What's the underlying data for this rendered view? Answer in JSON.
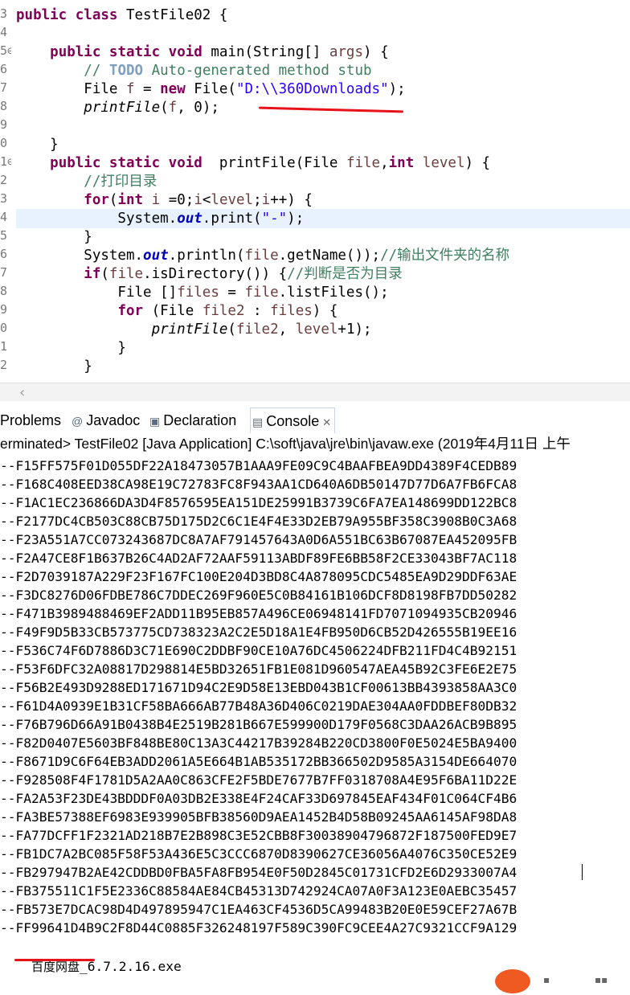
{
  "editor": {
    "line_numbers": [
      "3",
      "4",
      "5⊖",
      "6",
      "7",
      "8",
      "9",
      "0",
      "1⊖",
      "2",
      "3",
      "4",
      "5",
      "6",
      "7",
      "8",
      "9",
      "0",
      "1",
      "2"
    ],
    "lines": [
      [
        {
          "t": "public class",
          "c": "kw"
        },
        {
          "t": " TestFile02 {"
        }
      ],
      [],
      [
        {
          "t": "    "
        },
        {
          "t": "public static void",
          "c": "kw"
        },
        {
          "t": " main(String[] "
        },
        {
          "t": "args",
          "c": "var"
        },
        {
          "t": ") {"
        }
      ],
      [
        {
          "t": "        // ",
          "c": "cm"
        },
        {
          "t": "TODO",
          "c": "todo"
        },
        {
          "t": " Auto-generated method stub",
          "c": "cm"
        }
      ],
      [
        {
          "t": "        File "
        },
        {
          "t": "f",
          "c": "var"
        },
        {
          "t": " = "
        },
        {
          "t": "new",
          "c": "kw"
        },
        {
          "t": " File("
        },
        {
          "t": "\"D:\\\\360Downloads\"",
          "c": "str"
        },
        {
          "t": ");"
        }
      ],
      [
        {
          "t": "        "
        },
        {
          "t": "printFile",
          "c": "ital"
        },
        {
          "t": "("
        },
        {
          "t": "f",
          "c": "var"
        },
        {
          "t": ", 0);"
        }
      ],
      [],
      [
        {
          "t": "    }"
        }
      ],
      [
        {
          "t": "    "
        },
        {
          "t": "public static void",
          "c": "kw"
        },
        {
          "t": "  printFile(File "
        },
        {
          "t": "file",
          "c": "var"
        },
        {
          "t": ","
        },
        {
          "t": "int",
          "c": "kw"
        },
        {
          "t": " "
        },
        {
          "t": "level",
          "c": "var"
        },
        {
          "t": ") {"
        }
      ],
      [
        {
          "t": "        //打印目录",
          "c": "cm"
        }
      ],
      [
        {
          "t": "        "
        },
        {
          "t": "for",
          "c": "kw"
        },
        {
          "t": "("
        },
        {
          "t": "int",
          "c": "kw"
        },
        {
          "t": " "
        },
        {
          "t": "i",
          "c": "var"
        },
        {
          "t": " =0;"
        },
        {
          "t": "i",
          "c": "var"
        },
        {
          "t": "<"
        },
        {
          "t": "level",
          "c": "var"
        },
        {
          "t": ";"
        },
        {
          "t": "i",
          "c": "var"
        },
        {
          "t": "++) {"
        }
      ],
      [
        {
          "t": "            System."
        },
        {
          "t": "out",
          "c": "fld"
        },
        {
          "t": ".print("
        },
        {
          "t": "\"-\"",
          "c": "str"
        },
        {
          "t": ");"
        }
      ],
      [
        {
          "t": "        }"
        }
      ],
      [
        {
          "t": "        System."
        },
        {
          "t": "out",
          "c": "fld"
        },
        {
          "t": ".println("
        },
        {
          "t": "file",
          "c": "var"
        },
        {
          "t": ".getName());"
        },
        {
          "t": "//输出文件夹的名称",
          "c": "cm"
        }
      ],
      [
        {
          "t": "        "
        },
        {
          "t": "if",
          "c": "kw"
        },
        {
          "t": "("
        },
        {
          "t": "file",
          "c": "var"
        },
        {
          "t": ".isDirectory()) {"
        },
        {
          "t": "//判断是否为目录",
          "c": "cm"
        }
      ],
      [
        {
          "t": "            File []"
        },
        {
          "t": "files",
          "c": "var"
        },
        {
          "t": " = "
        },
        {
          "t": "file",
          "c": "var"
        },
        {
          "t": ".listFiles();"
        }
      ],
      [
        {
          "t": "            "
        },
        {
          "t": "for",
          "c": "kw"
        },
        {
          "t": " (File "
        },
        {
          "t": "file2",
          "c": "var"
        },
        {
          "t": " : "
        },
        {
          "t": "files",
          "c": "var"
        },
        {
          "t": ") {"
        }
      ],
      [
        {
          "t": "                "
        },
        {
          "t": "printFile",
          "c": "ital"
        },
        {
          "t": "("
        },
        {
          "t": "file2",
          "c": "var"
        },
        {
          "t": ", "
        },
        {
          "t": "level",
          "c": "var"
        },
        {
          "t": "+1);"
        }
      ],
      [
        {
          "t": "            }"
        }
      ],
      [
        {
          "t": "        }"
        }
      ]
    ]
  },
  "tabs": [
    {
      "label": "Problems",
      "icon": "problems-icon",
      "glyph": ""
    },
    {
      "label": "Javadoc",
      "icon": "at-icon",
      "glyph": "@"
    },
    {
      "label": "Declaration",
      "icon": "declaration-icon",
      "glyph": "▣"
    },
    {
      "label": "Console",
      "icon": "console-icon",
      "glyph": "▤",
      "close": "✕"
    }
  ],
  "console_status": "erminated> TestFile02 [Java Application] C:\\soft\\java\\jre\\bin\\javaw.exe (2019年4月11日 上午",
  "console_lines": [
    "--F15FF575F01D055DF22A18473057B1AAA9FE09C9C4BAAFBEA9DD4389F4CEDB89",
    "--F168C408EED38CA98E19C72783FC8F943AA1CD640A6DB50147D77D6A7FB6FCA8",
    "--F1AC1EC236866DA3D4F8576595EA151DE25991B3739C6FA7EA148699DD122BC8",
    "--F2177DC4CB503C88CB75D175D2C6C1E4F4E33D2EB79A955BF358C3908B0C3A68",
    "--F23A551A7CC073243687DC8A7AF791457643A0D6A551BC63B67087EA452095FB",
    "--F2A47CE8F1B637B26C4AD2AF72AAF59113ABDF89FE6BB58F2CE33043BF7AC118",
    "--F2D7039187A229F23F167FC100E204D3BD8C4A878095CDC5485EA9D29DDF63AE",
    "--F3DC8276D06FDBE786C7DDEC269F960E5C0B84161B106DCF8D8198FB7DD50282",
    "--F471B3989488469EF2ADD11B95EB857A496CE06948141FD7071094935CB20946",
    "--F49F9D5B33CB573775CD738323A2C2E5D18A1E4FB950D6CB52D426555B19EE16",
    "--F536C74F6D7886D3C71E690C2DDBF90CE10A76DC4506224DFB211FD4C4B92151",
    "--F53F6DFC32A08817D298814E5BD32651FB1E081D960547AEA45B92C3FE6E2E75",
    "--F56B2E493D9288ED171671D94C2E9D58E13EBD043B1CF00613BB4393858AA3C0",
    "--F61D4A0939E1B31CF58BA666AB77B48A36D406C0219DAE304AA0FDDBEF80DB32",
    "--F76B796D66A91B0438B4E2519B281B667E599900D179F0568C3DAA26ACB9B895",
    "--F82D0407E5603BF848BE80C13A3C44217B39284B220CD3800F0E5024E5BA9400",
    "--F8671D9C6F64EB3ADD2061A5E664B1AB535172BB366502D9585A3154DE664070",
    "--F928508F4F1781D5A2AA0C863CFE2F5BDE7677B7FF0318708A4E95F6BA11D22E",
    "--FA2A53F23DE43BDDDF0A03DB2E338E4F24CAF33D697845EAF434F01C064CF4B6",
    "--FA3BE57388EF6983E939905BFB38560D9AEA1452B4D58B09245AA6145AF98DA8",
    "--FA77DCFF1F2321AD218B7E2B898C3E52CBB8F30038904796872F187500FED9E7",
    "--FB1DC7A2BC085F58F53A436E5C3CCC6870D8390627CE36056A4076C350CE52E9",
    "--FB297947B2AE42CDDBD0FBA5FA8FB954E0F50D2845C01731CFD2E6D2933007A4",
    "--FB375511C1F5E2336C88584AE84CB45313D742924CA07A0F3A123E0AEBC35457",
    "--FB573E7DCAC98D4D497895947C1EA463CF4536D5CA99483B20E0E59CEF27A67B",
    "--FF99641D4B9C2F8D44C0885F326248197F589C390FC9CEE4A27C9321CCF9A129"
  ],
  "exe_line": {
    "cjk": "百度网盘",
    "rest": "_6.7.2.16.exe"
  },
  "colors": {
    "keyword": "#7f0055",
    "string": "#2a00ff",
    "comment": "#3f7f5f",
    "annotation_red": "#e8121a"
  }
}
